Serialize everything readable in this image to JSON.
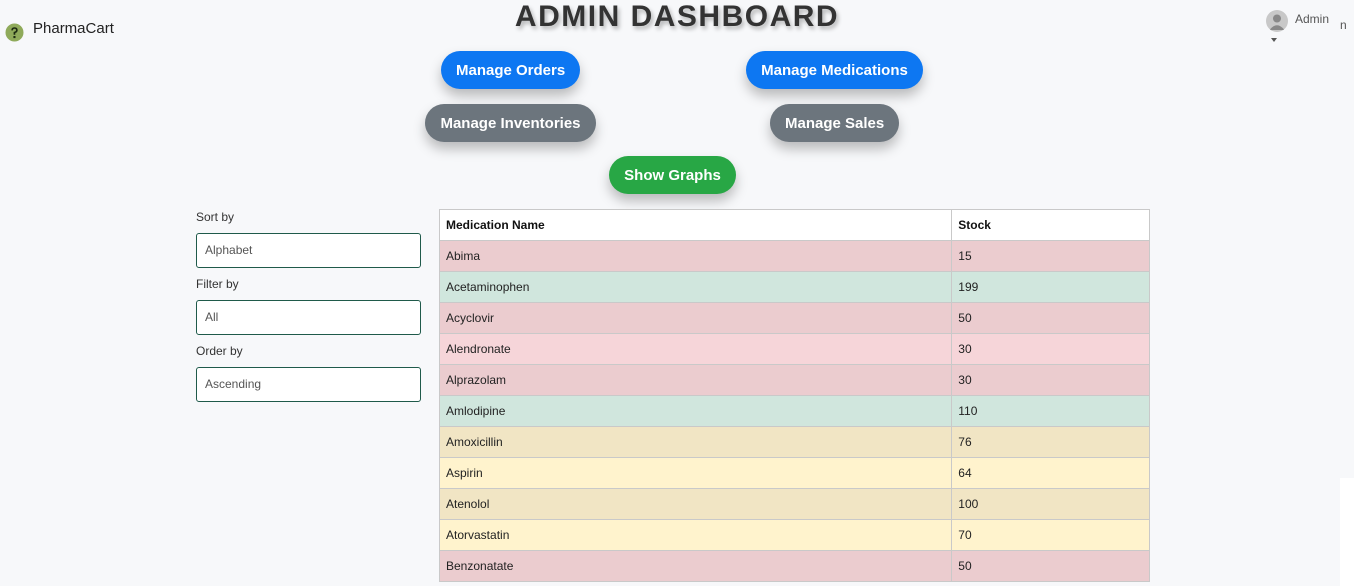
{
  "brand": {
    "name": "PharmaCart",
    "icon": "pharmacy-logo-icon"
  },
  "page": {
    "title": "ADMIN DASHBOARD"
  },
  "user": {
    "name": "Admin",
    "extra": "n",
    "icon": "user-avatar-icon"
  },
  "buttons": {
    "manage_orders": "Manage Orders",
    "manage_medications": "Manage Medications",
    "manage_inventories": "Manage Inventories",
    "manage_sales": "Manage Sales",
    "show_graphs": "Show Graphs"
  },
  "colors": {
    "primary": "#0d77f2",
    "secondary": "#6c757d",
    "success": "#28a745",
    "row_low": "#ebcccf",
    "row_mid": "#f1e5c4",
    "row_high": "#d0e6dd"
  },
  "filters": {
    "sort": {
      "label": "Sort by",
      "value": "Alphabet"
    },
    "filter": {
      "label": "Filter by",
      "value": "All"
    },
    "order": {
      "label": "Order by",
      "value": "Ascending"
    }
  },
  "table": {
    "headers": [
      "Medication Name",
      "Stock"
    ],
    "rows": [
      {
        "name": "Abima",
        "stock": "15",
        "status": "red"
      },
      {
        "name": "Acetaminophen",
        "stock": "199",
        "status": "green"
      },
      {
        "name": "Acyclovir",
        "stock": "50",
        "status": "red"
      },
      {
        "name": "Alendronate",
        "stock": "30",
        "status": "pink"
      },
      {
        "name": "Alprazolam",
        "stock": "30",
        "status": "red"
      },
      {
        "name": "Amlodipine",
        "stock": "110",
        "status": "green"
      },
      {
        "name": "Amoxicillin",
        "stock": "76",
        "status": "tan"
      },
      {
        "name": "Aspirin",
        "stock": "64",
        "status": "yellow"
      },
      {
        "name": "Atenolol",
        "stock": "100",
        "status": "tan"
      },
      {
        "name": "Atorvastatin",
        "stock": "70",
        "status": "yellow"
      },
      {
        "name": "Benzonatate",
        "stock": "50",
        "status": "red"
      }
    ]
  }
}
